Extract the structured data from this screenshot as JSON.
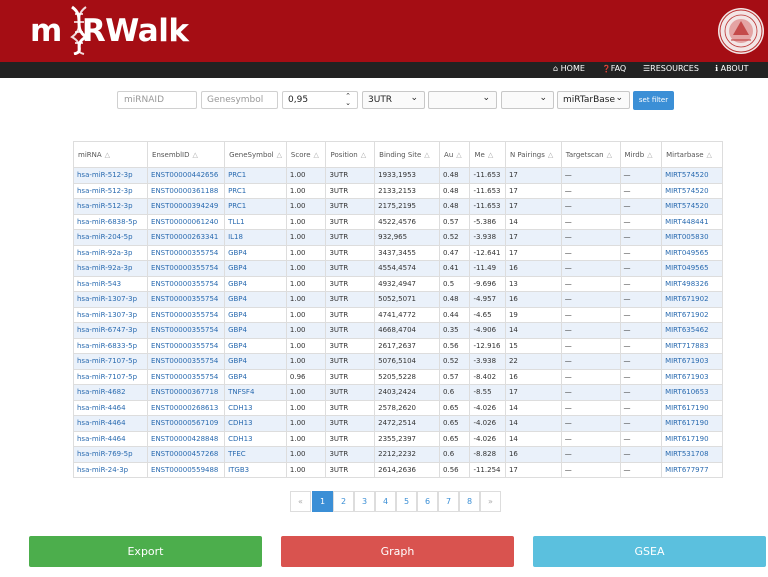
{
  "header": {
    "title": "m RWalk"
  },
  "nav": [
    {
      "icon": "home-icon",
      "glyph": "⌂",
      "label": "HOME"
    },
    {
      "icon": "question-icon",
      "glyph": "❓",
      "label": "FAQ"
    },
    {
      "icon": "list-icon",
      "glyph": "☰",
      "label": "RESOURCES"
    },
    {
      "icon": "info-icon",
      "glyph": "ℹ",
      "label": "ABOUT"
    }
  ],
  "filters": {
    "mirna_placeholder": "miRNAID",
    "gene_placeholder": "Genesymbol",
    "score_value": "0,95",
    "position_value": "3UTR",
    "select2_value": "",
    "select3_value": "",
    "db_value": "miRTarBase",
    "button_label": "set filter"
  },
  "table": {
    "columns": [
      "miRNA",
      "EnsemblID",
      "GeneSymbol",
      "Score",
      "Position",
      "Binding Site",
      "Au",
      "Me",
      "N Pairings",
      "Targetscan",
      "Mirdb",
      "Mirtarbase"
    ],
    "rows": [
      [
        "hsa-miR-512-3p",
        "ENST00000442656",
        "PRC1",
        "1.00",
        "3UTR",
        "1933,1953",
        "0.48",
        "-11.653",
        "17",
        "—",
        "—",
        "MIRT574520"
      ],
      [
        "hsa-miR-512-3p",
        "ENST00000361188",
        "PRC1",
        "1.00",
        "3UTR",
        "2133,2153",
        "0.48",
        "-11.653",
        "17",
        "—",
        "—",
        "MIRT574520"
      ],
      [
        "hsa-miR-512-3p",
        "ENST00000394249",
        "PRC1",
        "1.00",
        "3UTR",
        "2175,2195",
        "0.48",
        "-11.653",
        "17",
        "—",
        "—",
        "MIRT574520"
      ],
      [
        "hsa-miR-6838-5p",
        "ENST00000061240",
        "TLL1",
        "1.00",
        "3UTR",
        "4522,4576",
        "0.57",
        "-5.386",
        "14",
        "—",
        "—",
        "MIRT448441"
      ],
      [
        "hsa-miR-204-5p",
        "ENST00000263341",
        "IL18",
        "1.00",
        "3UTR",
        "932,965",
        "0.52",
        "-3.938",
        "17",
        "—",
        "—",
        "MIRT005830"
      ],
      [
        "hsa-miR-92a-3p",
        "ENST00000355754",
        "GBP4",
        "1.00",
        "3UTR",
        "3437,3455",
        "0.47",
        "-12.641",
        "17",
        "—",
        "—",
        "MIRT049565"
      ],
      [
        "hsa-miR-92a-3p",
        "ENST00000355754",
        "GBP4",
        "1.00",
        "3UTR",
        "4554,4574",
        "0.41",
        "-11.49",
        "16",
        "—",
        "—",
        "MIRT049565"
      ],
      [
        "hsa-miR-543",
        "ENST00000355754",
        "GBP4",
        "1.00",
        "3UTR",
        "4932,4947",
        "0.5",
        "-9.696",
        "13",
        "—",
        "—",
        "MIRT498326"
      ],
      [
        "hsa-miR-1307-3p",
        "ENST00000355754",
        "GBP4",
        "1.00",
        "3UTR",
        "5052,5071",
        "0.48",
        "-4.957",
        "16",
        "—",
        "—",
        "MIRT671902"
      ],
      [
        "hsa-miR-1307-3p",
        "ENST00000355754",
        "GBP4",
        "1.00",
        "3UTR",
        "4741,4772",
        "0.44",
        "-4.65",
        "19",
        "—",
        "—",
        "MIRT671902"
      ],
      [
        "hsa-miR-6747-3p",
        "ENST00000355754",
        "GBP4",
        "1.00",
        "3UTR",
        "4668,4704",
        "0.35",
        "-4.906",
        "14",
        "—",
        "—",
        "MIRT635462"
      ],
      [
        "hsa-miR-6833-5p",
        "ENST00000355754",
        "GBP4",
        "1.00",
        "3UTR",
        "2617,2637",
        "0.56",
        "-12.916",
        "15",
        "—",
        "—",
        "MIRT717883"
      ],
      [
        "hsa-miR-7107-5p",
        "ENST00000355754",
        "GBP4",
        "1.00",
        "3UTR",
        "5076,5104",
        "0.52",
        "-3.938",
        "22",
        "—",
        "—",
        "MIRT671903"
      ],
      [
        "hsa-miR-7107-5p",
        "ENST00000355754",
        "GBP4",
        "0.96",
        "3UTR",
        "5205,5228",
        "0.57",
        "-8.402",
        "16",
        "—",
        "—",
        "MIRT671903"
      ],
      [
        "hsa-miR-4682",
        "ENST00000367718",
        "TNFSF4",
        "1.00",
        "3UTR",
        "2403,2424",
        "0.6",
        "-8.55",
        "17",
        "—",
        "—",
        "MIRT610653"
      ],
      [
        "hsa-miR-4464",
        "ENST00000268613",
        "CDH13",
        "1.00",
        "3UTR",
        "2578,2620",
        "0.65",
        "-4.026",
        "14",
        "—",
        "—",
        "MIRT617190"
      ],
      [
        "hsa-miR-4464",
        "ENST00000567109",
        "CDH13",
        "1.00",
        "3UTR",
        "2472,2514",
        "0.65",
        "-4.026",
        "14",
        "—",
        "—",
        "MIRT617190"
      ],
      [
        "hsa-miR-4464",
        "ENST00000428848",
        "CDH13",
        "1.00",
        "3UTR",
        "2355,2397",
        "0.65",
        "-4.026",
        "14",
        "—",
        "—",
        "MIRT617190"
      ],
      [
        "hsa-miR-769-5p",
        "ENST00000457268",
        "TFEC",
        "1.00",
        "3UTR",
        "2212,2232",
        "0.6",
        "-8.828",
        "16",
        "—",
        "—",
        "MIRT531708"
      ],
      [
        "hsa-miR-24-3p",
        "ENST00000559488",
        "ITGB3",
        "1.00",
        "3UTR",
        "2614,2636",
        "0.56",
        "-11.254",
        "17",
        "—",
        "—",
        "MIRT677977"
      ]
    ]
  },
  "pagination": {
    "prev": "«",
    "pages": [
      "1",
      "2",
      "3",
      "4",
      "5",
      "6",
      "7",
      "8"
    ],
    "next": "»",
    "current": "1"
  },
  "actions": {
    "export": "Export",
    "graph": "Graph",
    "gsea": "GSEA"
  },
  "colors": {
    "header": "#a50d14",
    "navbar": "#222222",
    "export": "#4cae4c",
    "graph": "#d9534f",
    "gsea": "#5bc0de",
    "link": "#2a6bb0"
  }
}
